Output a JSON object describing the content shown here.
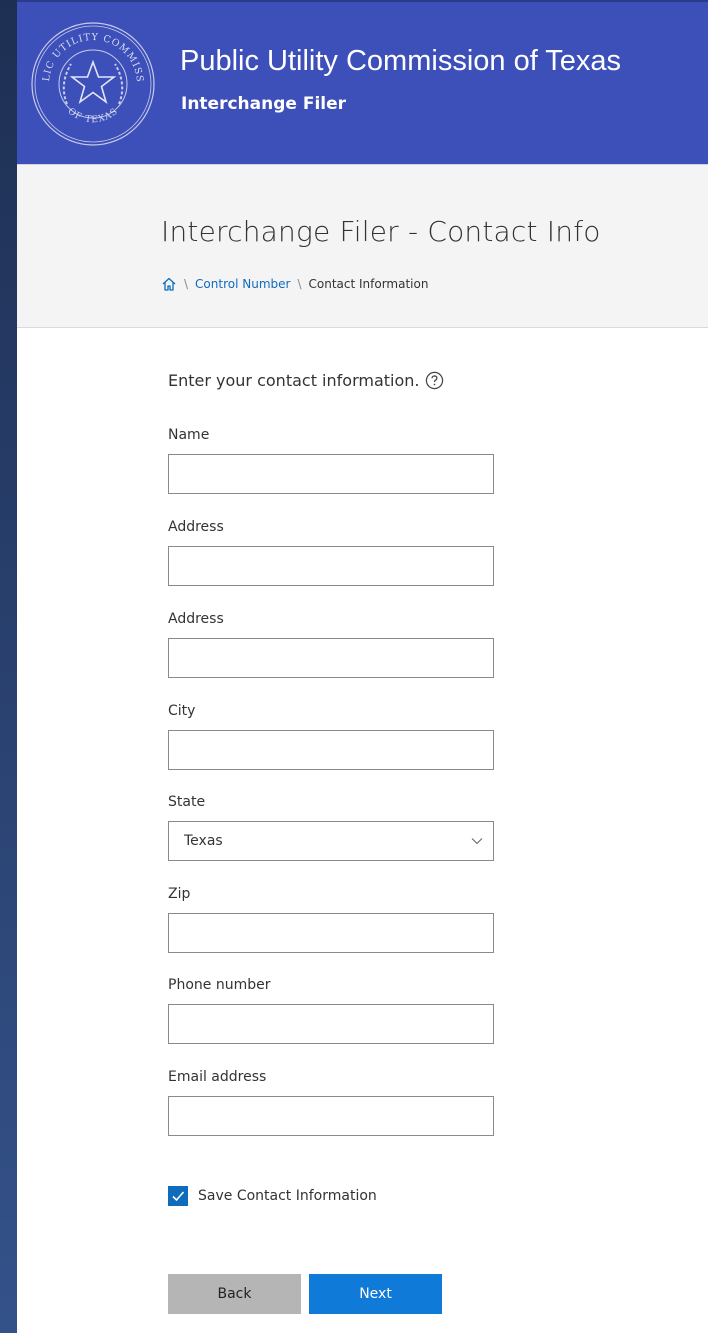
{
  "header": {
    "title": "Public Utility Commission of Texas",
    "subtitle": "Interchange Filer",
    "seal_top_text": "PUBLIC UTILITY COMMISSION",
    "seal_bottom_text": "OF TEXAS"
  },
  "page": {
    "title": "Interchange Filer - Contact Info",
    "breadcrumb": {
      "home_icon": "home-icon",
      "items": [
        "Control Number",
        "Contact Information"
      ]
    }
  },
  "form": {
    "intro": "Enter your contact information.",
    "help_icon": "question-circle-icon",
    "fields": [
      {
        "label": "Name",
        "value": ""
      },
      {
        "label": "Address",
        "value": ""
      },
      {
        "label": "Address",
        "value": ""
      },
      {
        "label": "City",
        "value": ""
      },
      {
        "label": "State",
        "value": "Texas"
      },
      {
        "label": "Zip",
        "value": ""
      },
      {
        "label": "Phone number",
        "value": ""
      },
      {
        "label": "Email address",
        "value": ""
      }
    ],
    "save_checkbox": {
      "label": "Save Contact Information",
      "checked": true
    },
    "buttons": {
      "back": "Back",
      "next": "Next"
    }
  },
  "colors": {
    "header_bg": "#3d4fb9",
    "accent": "#0f6cbd",
    "next_button": "#0f7ad8",
    "back_button": "#b5b5b5"
  }
}
